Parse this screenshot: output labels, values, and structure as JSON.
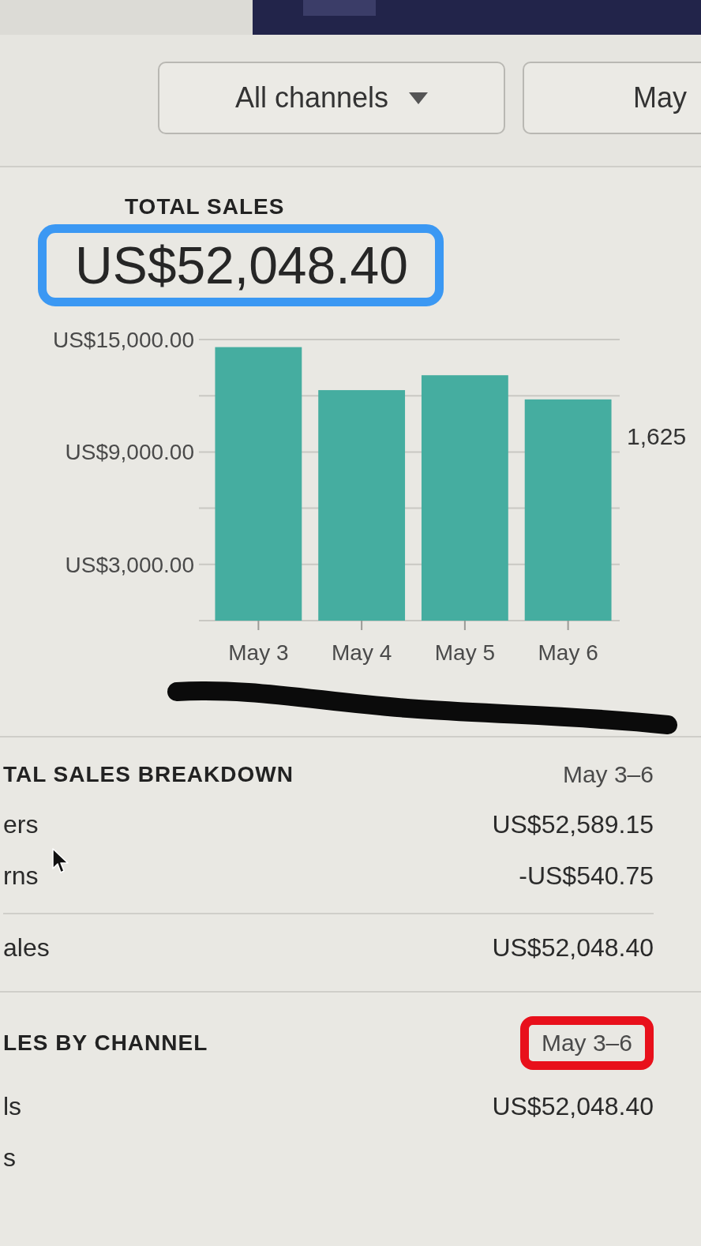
{
  "filters": {
    "channel": {
      "label": "All channels"
    },
    "date_range": {
      "label": "May"
    }
  },
  "total_sales": {
    "title": "TOTAL SALES",
    "amount": "US$52,048.40",
    "marked": true
  },
  "sales_chart": {
    "y_labels": [
      "US$15,000.00",
      "US$9,000.00",
      "US$3,000.00"
    ],
    "x_labels": [
      "May 3",
      "May 4",
      "May 5",
      "May 6"
    ],
    "side_label": "1,625"
  },
  "breakdown": {
    "title": "TAL SALES BREAKDOWN",
    "period": "May 3–6",
    "rows": [
      {
        "label": "ers",
        "value": "US$52,589.15",
        "kind": "line"
      },
      {
        "label": "rns",
        "value": "-US$540.75",
        "kind": "line"
      },
      {
        "label": "ales",
        "value": "US$52,048.40",
        "kind": "total"
      }
    ]
  },
  "sales_by_channel": {
    "title": "LES BY CHANNEL",
    "period": "May 3–6",
    "period_marked": true,
    "rows": [
      {
        "label": "ls",
        "value": "US$52,048.40"
      },
      {
        "label": "s"
      }
    ]
  }
}
